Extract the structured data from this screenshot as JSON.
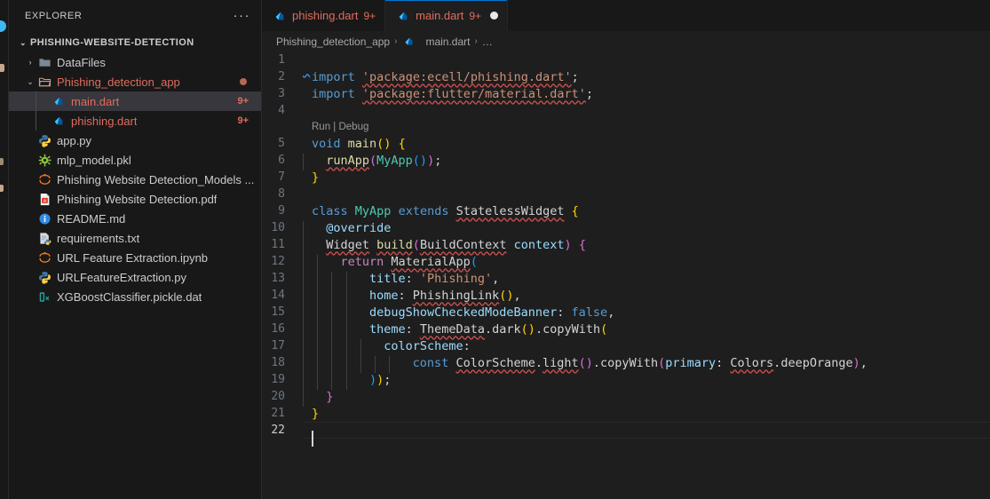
{
  "sidebar": {
    "header_title": "EXPLORER",
    "more_actions": "···",
    "root": {
      "label": "PHISHING-WEBSITE-DETECTION",
      "expanded": true,
      "twisty": "⌄"
    },
    "items": [
      {
        "label": "DataFiles",
        "icon": "folder-icon",
        "level": 1,
        "twisty": "›",
        "kind": "folder",
        "badge": "",
        "state": "normal",
        "selected": false
      },
      {
        "label": "Phishing_detection_app",
        "icon": "folder-open-icon",
        "level": 1,
        "twisty": "⌄",
        "kind": "folder",
        "badge": "dot",
        "state": "warn",
        "selected": false
      },
      {
        "label": "main.dart",
        "icon": "dart-icon",
        "level": 2,
        "twisty": "",
        "kind": "file",
        "badge": "9+",
        "state": "warn",
        "selected": true
      },
      {
        "label": "phishing.dart",
        "icon": "dart-icon",
        "level": 2,
        "twisty": "",
        "kind": "file",
        "badge": "9+",
        "state": "warn",
        "selected": false
      },
      {
        "label": "app.py",
        "icon": "python-icon",
        "level": 1,
        "twisty": "",
        "kind": "file",
        "badge": "",
        "state": "normal",
        "selected": false
      },
      {
        "label": "mlp_model.pkl",
        "icon": "pkl-icon",
        "level": 1,
        "twisty": "",
        "kind": "file",
        "badge": "",
        "state": "normal",
        "selected": false
      },
      {
        "label": "Phishing Website Detection_Models ...",
        "icon": "jupyter-icon",
        "level": 1,
        "twisty": "",
        "kind": "file",
        "badge": "",
        "state": "normal",
        "selected": false
      },
      {
        "label": "Phishing Website Detection.pdf",
        "icon": "pdf-icon",
        "level": 1,
        "twisty": "",
        "kind": "file",
        "badge": "",
        "state": "normal",
        "selected": false
      },
      {
        "label": "README.md",
        "icon": "info-icon",
        "level": 1,
        "twisty": "",
        "kind": "file",
        "badge": "",
        "state": "normal",
        "selected": false
      },
      {
        "label": "requirements.txt",
        "icon": "requirements-icon",
        "level": 1,
        "twisty": "",
        "kind": "file",
        "badge": "",
        "state": "normal",
        "selected": false
      },
      {
        "label": "URL Feature Extraction.ipynb",
        "icon": "jupyter-icon",
        "level": 1,
        "twisty": "",
        "kind": "file",
        "badge": "",
        "state": "normal",
        "selected": false
      },
      {
        "label": "URLFeatureExtraction.py",
        "icon": "python-icon",
        "level": 1,
        "twisty": "",
        "kind": "file",
        "badge": "",
        "state": "normal",
        "selected": false
      },
      {
        "label": "XGBoostClassifier.pickle.dat",
        "icon": "dat-icon",
        "level": 1,
        "twisty": "",
        "kind": "file",
        "badge": "",
        "state": "normal",
        "selected": false
      }
    ]
  },
  "tabs": [
    {
      "name": "phishing.dart",
      "icon": "dart-icon",
      "badge": "9+",
      "active": false,
      "dirty": false
    },
    {
      "name": "main.dart",
      "icon": "dart-icon",
      "badge": "9+",
      "active": true,
      "dirty": true
    }
  ],
  "breadcrumb": {
    "segments": [
      "Phishing_detection_app",
      "main.dart",
      "…"
    ],
    "separator": "›",
    "file_icon": "dart-icon"
  },
  "editor": {
    "language": "dart",
    "cursor_line": 22,
    "codelens": {
      "line_after": 4,
      "text": "Run | Debug"
    },
    "lines": [
      {
        "n": 1,
        "indent": 0,
        "tokens": []
      },
      {
        "n": 2,
        "indent": 0,
        "tokens": [
          {
            "t": "import",
            "c": "kw"
          },
          {
            "t": " ",
            "c": "plain"
          },
          {
            "t": "'package:ecell/phishing.dart'",
            "c": "str squig"
          },
          {
            "t": ";",
            "c": "plain"
          }
        ]
      },
      {
        "n": 3,
        "indent": 0,
        "tokens": [
          {
            "t": "import",
            "c": "kw"
          },
          {
            "t": " ",
            "c": "plain"
          },
          {
            "t": "'package:flutter/material.dart'",
            "c": "str squig"
          },
          {
            "t": ";",
            "c": "plain"
          }
        ]
      },
      {
        "n": 4,
        "indent": 0,
        "tokens": []
      },
      {
        "n": 5,
        "indent": 0,
        "tokens": [
          {
            "t": "void",
            "c": "kw"
          },
          {
            "t": " ",
            "c": "plain"
          },
          {
            "t": "main",
            "c": "fn"
          },
          {
            "t": "()",
            "c": "br1"
          },
          {
            "t": " ",
            "c": "plain"
          },
          {
            "t": "{",
            "c": "br1"
          }
        ]
      },
      {
        "n": 6,
        "indent": 1,
        "tokens": [
          {
            "t": "runApp",
            "c": "fn squig"
          },
          {
            "t": "(",
            "c": "br2"
          },
          {
            "t": "MyApp",
            "c": "type"
          },
          {
            "t": "()",
            "c": "br3"
          },
          {
            "t": ")",
            "c": "br2"
          },
          {
            "t": ";",
            "c": "plain"
          }
        ]
      },
      {
        "n": 7,
        "indent": 0,
        "tokens": [
          {
            "t": "}",
            "c": "br1"
          }
        ]
      },
      {
        "n": 8,
        "indent": 0,
        "tokens": []
      },
      {
        "n": 9,
        "indent": 0,
        "tokens": [
          {
            "t": "class",
            "c": "kw"
          },
          {
            "t": " ",
            "c": "plain"
          },
          {
            "t": "MyApp",
            "c": "type"
          },
          {
            "t": " ",
            "c": "plain"
          },
          {
            "t": "extends",
            "c": "kw"
          },
          {
            "t": " ",
            "c": "plain"
          },
          {
            "t": "StatelessWidget",
            "c": "plain squig"
          },
          {
            "t": " ",
            "c": "plain"
          },
          {
            "t": "{",
            "c": "br1"
          }
        ]
      },
      {
        "n": 10,
        "indent": 1,
        "tokens": [
          {
            "t": "@override",
            "c": "anno"
          }
        ]
      },
      {
        "n": 11,
        "indent": 1,
        "tokens": [
          {
            "t": "Widget",
            "c": "plain squig"
          },
          {
            "t": " ",
            "c": "plain"
          },
          {
            "t": "build",
            "c": "fn squig"
          },
          {
            "t": "(",
            "c": "br2"
          },
          {
            "t": "BuildContext",
            "c": "plain squig"
          },
          {
            "t": " ",
            "c": "plain"
          },
          {
            "t": "context",
            "c": "var"
          },
          {
            "t": ")",
            "c": "br2"
          },
          {
            "t": " ",
            "c": "plain"
          },
          {
            "t": "{",
            "c": "br2"
          }
        ]
      },
      {
        "n": 12,
        "indent": 2,
        "tokens": [
          {
            "t": "return",
            "c": "kwc"
          },
          {
            "t": " ",
            "c": "plain"
          },
          {
            "t": "MaterialApp",
            "c": "plain squig"
          },
          {
            "t": "(",
            "c": "br3"
          }
        ]
      },
      {
        "n": 13,
        "indent": 4,
        "tokens": [
          {
            "t": "title",
            "c": "var"
          },
          {
            "t": ": ",
            "c": "plain"
          },
          {
            "t": "'Phishing'",
            "c": "str"
          },
          {
            "t": ",",
            "c": "plain"
          }
        ]
      },
      {
        "n": 14,
        "indent": 4,
        "tokens": [
          {
            "t": "home",
            "c": "var"
          },
          {
            "t": ": ",
            "c": "plain"
          },
          {
            "t": "PhishingLink",
            "c": "plain squig"
          },
          {
            "t": "()",
            "c": "br1"
          },
          {
            "t": ",",
            "c": "plain"
          }
        ]
      },
      {
        "n": 15,
        "indent": 4,
        "tokens": [
          {
            "t": "debugShowCheckedModeBanner",
            "c": "var"
          },
          {
            "t": ": ",
            "c": "plain"
          },
          {
            "t": "false",
            "c": "kw"
          },
          {
            "t": ",",
            "c": "plain"
          }
        ]
      },
      {
        "n": 16,
        "indent": 4,
        "tokens": [
          {
            "t": "theme",
            "c": "var"
          },
          {
            "t": ": ",
            "c": "plain"
          },
          {
            "t": "ThemeData",
            "c": "plain squig"
          },
          {
            "t": ".",
            "c": "plain"
          },
          {
            "t": "dark",
            "c": "plain"
          },
          {
            "t": "()",
            "c": "br1"
          },
          {
            "t": ".",
            "c": "plain"
          },
          {
            "t": "copyWith",
            "c": "plain"
          },
          {
            "t": "(",
            "c": "br1"
          }
        ]
      },
      {
        "n": 17,
        "indent": 5,
        "tokens": [
          {
            "t": "colorScheme",
            "c": "var"
          },
          {
            "t": ":",
            "c": "plain"
          }
        ]
      },
      {
        "n": 18,
        "indent": 7,
        "tokens": [
          {
            "t": "const",
            "c": "kw"
          },
          {
            "t": " ",
            "c": "plain"
          },
          {
            "t": "ColorScheme",
            "c": "plain squig"
          },
          {
            "t": ".",
            "c": "plain"
          },
          {
            "t": "light",
            "c": "plain squig"
          },
          {
            "t": "()",
            "c": "br2"
          },
          {
            "t": ".",
            "c": "plain"
          },
          {
            "t": "copyWith",
            "c": "plain"
          },
          {
            "t": "(",
            "c": "br2"
          },
          {
            "t": "primary",
            "c": "var"
          },
          {
            "t": ": ",
            "c": "plain"
          },
          {
            "t": "Colors",
            "c": "plain squig"
          },
          {
            "t": ".",
            "c": "plain"
          },
          {
            "t": "deepOrange",
            "c": "plain"
          },
          {
            "t": ")",
            "c": "br2"
          },
          {
            "t": ",",
            "c": "plain"
          }
        ]
      },
      {
        "n": 19,
        "indent": 4,
        "tokens": [
          {
            "t": ")",
            "c": "br3"
          },
          {
            "t": ")",
            "c": "br1"
          },
          {
            "t": ";",
            "c": "plain"
          }
        ]
      },
      {
        "n": 20,
        "indent": 1,
        "tokens": [
          {
            "t": "}",
            "c": "br2"
          }
        ]
      },
      {
        "n": 21,
        "indent": 0,
        "tokens": [
          {
            "t": "}",
            "c": "br1"
          }
        ]
      },
      {
        "n": 22,
        "indent": 0,
        "tokens": []
      }
    ]
  },
  "colors": {
    "editor_bg": "#1e1e1e",
    "sidebar_bg": "#181818",
    "selection_bg": "#37373d",
    "accent": "#0078d4",
    "warn_text": "#e06c5e",
    "error_squiggle": "#c84f4f",
    "info_squiggle": "#3794ff"
  }
}
